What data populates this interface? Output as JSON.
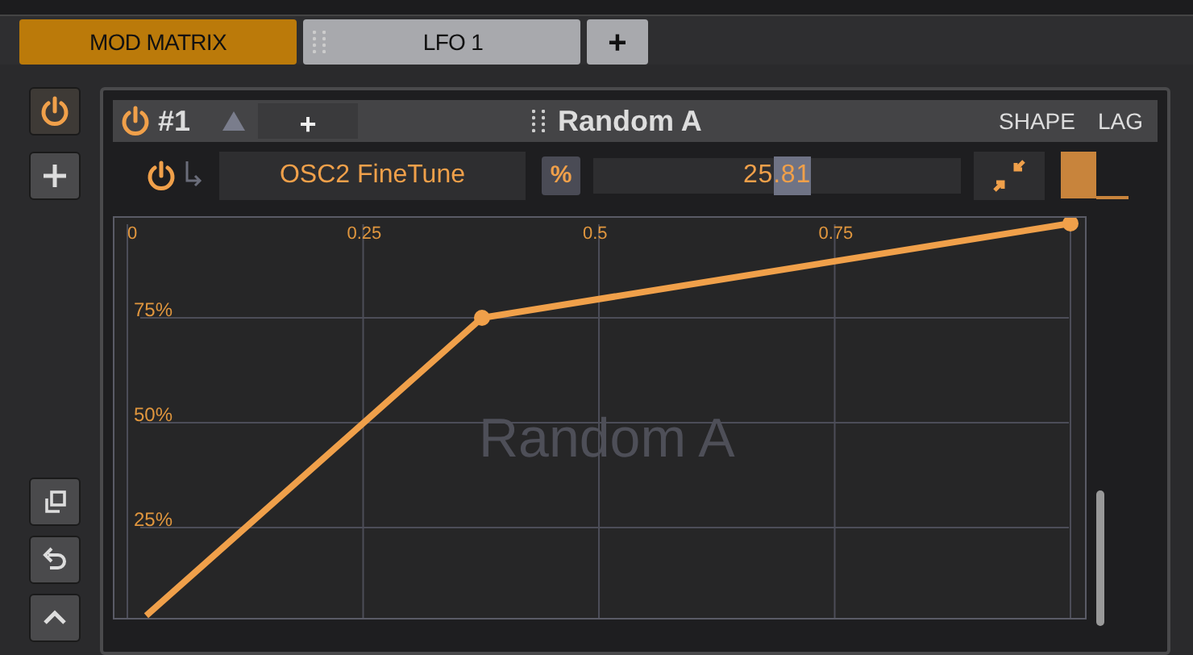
{
  "tabs": [
    {
      "label": "MOD MATRIX",
      "selected": true,
      "kind": "plain"
    },
    {
      "label": "LFO 1",
      "selected": false,
      "kind": "grip"
    },
    {
      "label": "+",
      "selected": false,
      "kind": "add"
    }
  ],
  "side_buttons": [
    {
      "kind": "power",
      "on": true
    },
    {
      "kind": "plus"
    },
    {
      "kind": "copy"
    },
    {
      "kind": "undo"
    },
    {
      "kind": "up"
    }
  ],
  "slot": {
    "power_on": true,
    "number": "#1",
    "add_label": "+",
    "title": "Random A",
    "actions": [
      "SHAPE",
      "LAG"
    ],
    "target": {
      "power_on": true,
      "name": "OSC2 FineTune",
      "unit": "%",
      "value": "25",
      "selected_text": ".81"
    },
    "overlay_label": "Random A",
    "chart_data": {
      "type": "line",
      "x": [
        0.02,
        0.376,
        1
      ],
      "series": [
        {
          "color": "#f0a04a",
          "values": [
            0.04,
            0.75,
            0.975
          ]
        }
      ],
      "xlim": [
        0,
        1
      ],
      "ylim": [
        0.027,
        1
      ],
      "grid": true,
      "xticks": [
        {
          "value": 0,
          "label": "0"
        },
        {
          "value": 0.25,
          "label": "0.25"
        },
        {
          "value": 0.5,
          "label": "0.5"
        },
        {
          "value": 0.75,
          "label": "0.75"
        }
      ],
      "yticks": [
        {
          "value": 0.25,
          "label": "25%"
        },
        {
          "value": 0.5,
          "label": "50%"
        },
        {
          "value": 0.75,
          "label": "75%"
        }
      ]
    }
  }
}
